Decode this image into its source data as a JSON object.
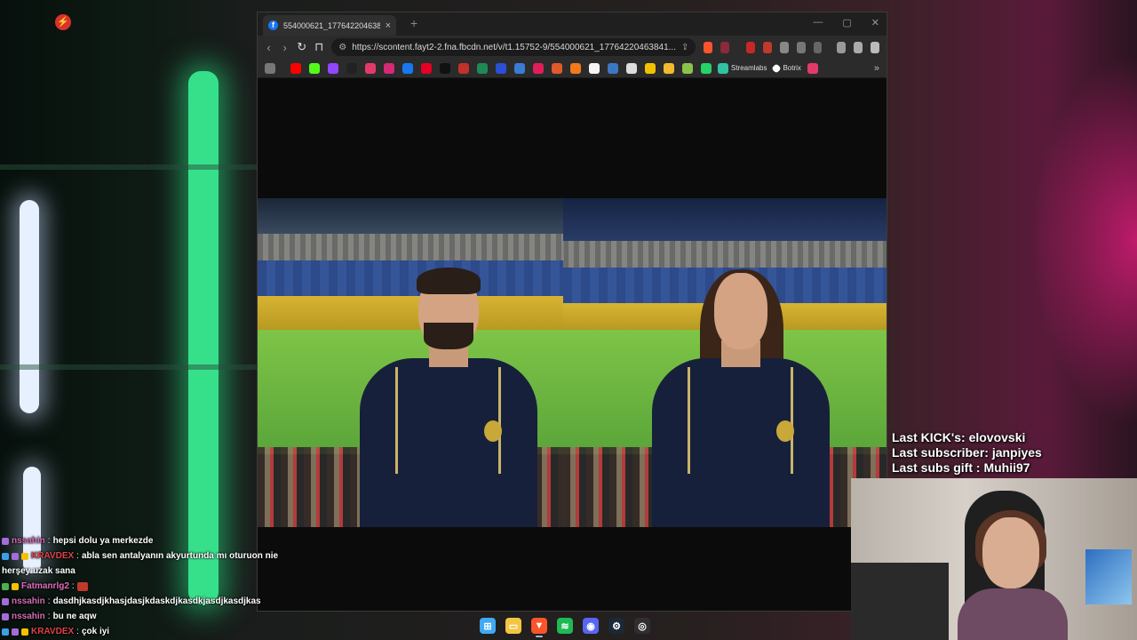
{
  "browser": {
    "tab_title": "554000621_1776422046384142",
    "tab_close": "×",
    "new_tab": "+",
    "window_controls": [
      "—",
      "▢",
      "✕"
    ],
    "url": "https://scontent.fayt2-2.fna.fbcdn.net/v/t1.15752-9/554000621_17764220463841...",
    "nav": {
      "back": "‹",
      "forward": "›",
      "reload": "↻",
      "bookmark": "⊓"
    },
    "bookmarks": [
      {
        "icon": "youtube-icon",
        "color": "#ff0000"
      },
      {
        "icon": "kick-icon",
        "color": "#53fc18"
      },
      {
        "icon": "twitch-icon",
        "color": "#9146ff"
      },
      {
        "icon": "x-icon",
        "color": "#222222"
      },
      {
        "icon": "tv-icon",
        "color": "#e23b6a"
      },
      {
        "icon": "instagram-icon",
        "color": "#d62976"
      },
      {
        "icon": "facebook-icon",
        "color": "#1877f2"
      },
      {
        "icon": "pinterest-icon",
        "color": "#e60023"
      },
      {
        "icon": "tiktok-icon",
        "color": "#111111"
      },
      {
        "icon": "red-square-icon",
        "color": "#c4302b"
      },
      {
        "icon": "green-chain-icon",
        "color": "#1e8a55"
      },
      {
        "icon": "b-icon",
        "color": "#2b4fd6"
      },
      {
        "icon": "play-icon",
        "color": "#3a7bd5"
      },
      {
        "icon": "y-icon",
        "color": "#e01e5a"
      },
      {
        "icon": "circle-icon",
        "color": "#e05a2b"
      },
      {
        "icon": "hb-icon",
        "color": "#f27a1a"
      },
      {
        "icon": "shop-icon",
        "color": "#f5f5f5"
      },
      {
        "icon": "chart-icon",
        "color": "#3b78c4"
      },
      {
        "icon": "news-icon",
        "color": "#dddddd"
      },
      {
        "icon": "yellow-icon",
        "color": "#f2c200"
      },
      {
        "icon": "binance-icon",
        "color": "#f3ba2f"
      },
      {
        "icon": "lime-icon",
        "color": "#8bc34a"
      },
      {
        "icon": "whatsapp-icon",
        "color": "#25d366"
      }
    ],
    "bookmark_labels": [
      {
        "icon": "streamlabs-icon",
        "color": "#31c3a2",
        "label": "Streamlabs"
      },
      {
        "icon": "botrix-icon",
        "color": "#ffffff",
        "label": "Botrix"
      }
    ],
    "bookmark_more": "»"
  },
  "chat": [
    {
      "user": "nssahin",
      "user_color": "#d46cb3",
      "sep": ":",
      "message": "hepsi dolu ya merkezde",
      "badges": [
        "#a46cd9"
      ]
    },
    {
      "user": "KRAVDEX",
      "user_color": "#e0414a",
      "sep": ":",
      "message": "abla sen antalyanın akyurtunda mı oturuon nie",
      "badges": [
        "#3aa0e8",
        "#a46cd9",
        "#f2c200"
      ]
    },
    {
      "user": "",
      "user_color": "#ffffff",
      "sep": "",
      "message": "herşey uzak sana",
      "badges": []
    },
    {
      "user": "Fatmanrlg2",
      "user_color": "#e06ab8",
      "sep": ":",
      "message": "",
      "badges": [
        "#4caf50",
        "#f2c200"
      ]
    },
    {
      "user": "nssahin",
      "user_color": "#d46cb3",
      "sep": ":",
      "message": "dasdhjkasdjkhasjdasjkdaskdjkasdkjasdjkasdjkas",
      "badges": [
        "#a46cd9"
      ]
    },
    {
      "user": "nssahin",
      "user_color": "#d46cb3",
      "sep": ":",
      "message": "bu ne aqw",
      "badges": [
        "#a46cd9"
      ]
    },
    {
      "user": "KRAVDEX",
      "user_color": "#e0414a",
      "sep": ":",
      "message": "çok iyi",
      "badges": [
        "#3aa0e8",
        "#a46cd9",
        "#f2c200"
      ]
    }
  ],
  "stream_info": {
    "last_kick": "Last KICK's: elovovski",
    "last_subscriber": "Last subscriber: janpiyes",
    "last_gift": "Last subs gift : Muhii97"
  },
  "taskbar": [
    {
      "icon": "windows-start-icon",
      "color": "#3fa9f5",
      "glyph": "⊞"
    },
    {
      "icon": "file-explorer-icon",
      "color": "#f4c542",
      "glyph": "▭"
    },
    {
      "icon": "brave-browser-icon",
      "color": "#fb542b",
      "glyph": "▼"
    },
    {
      "icon": "spotify-icon",
      "color": "#1db954",
      "glyph": "≋"
    },
    {
      "icon": "discord-icon",
      "color": "#5865f2",
      "glyph": "◉"
    },
    {
      "icon": "steam-icon",
      "color": "#1b2838",
      "glyph": "⚙"
    },
    {
      "icon": "obs-icon",
      "color": "#302e31",
      "glyph": "◎"
    }
  ]
}
